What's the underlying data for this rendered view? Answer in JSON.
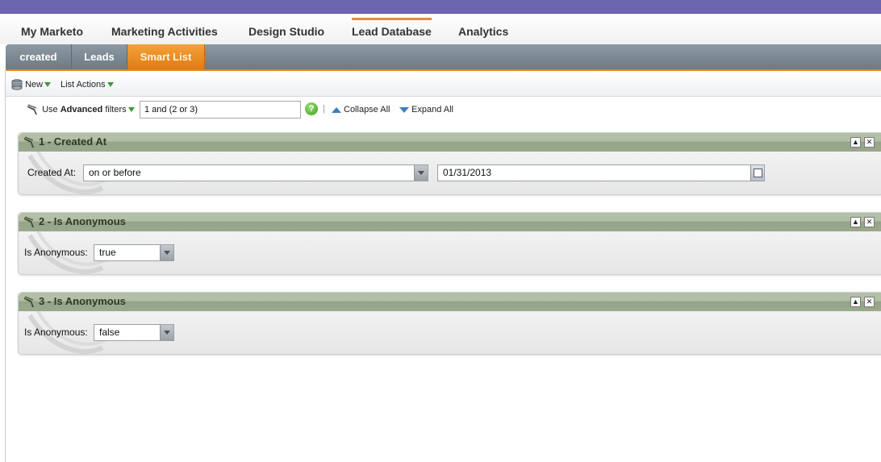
{
  "main_nav": {
    "tabs": [
      "My Marketo",
      "Marketing Activities",
      "Design Studio",
      "Lead Database",
      "Analytics"
    ],
    "active": "Lead Database"
  },
  "sub_nav": {
    "tabs": [
      "created",
      "Leads",
      "Smart List"
    ],
    "active": "Smart List"
  },
  "toolbar": {
    "new_label": "New",
    "list_actions_label": "List Actions"
  },
  "filter_bar": {
    "use_label": "Use",
    "advanced_label": "Advanced",
    "filters_label": "filters",
    "rule_value": "1 and (2 or 3)",
    "help_glyph": "?",
    "collapse_label": "Collapse All",
    "expand_label": "Expand All"
  },
  "filters": [
    {
      "title": "1 - Created At",
      "field_label": "Created At:",
      "operator": "on or before",
      "value": "01/31/2013"
    },
    {
      "title": "2 - Is Anonymous",
      "field_label": "Is Anonymous:",
      "value": "true"
    },
    {
      "title": "3 - Is Anonymous",
      "field_label": "Is Anonymous:",
      "value": "false"
    }
  ],
  "colors": {
    "accent_orange": "#e8841f",
    "header_purple": "#6e65b0",
    "filter_header_green": "#9aa98d"
  }
}
